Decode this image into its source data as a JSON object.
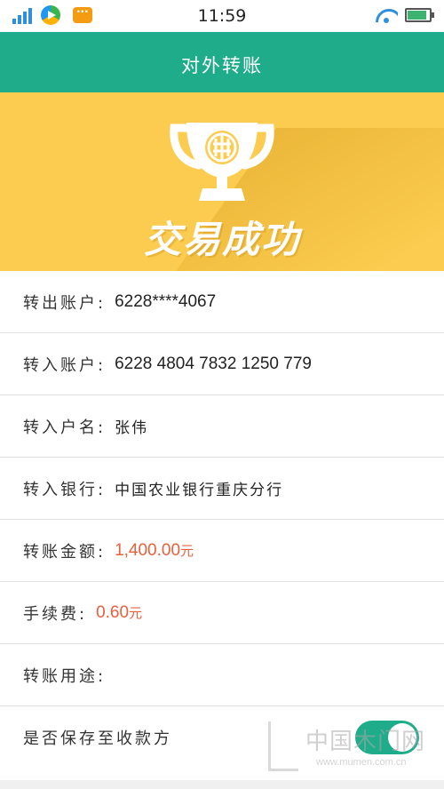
{
  "status_bar": {
    "time": "11:59",
    "battery_level": 0.9,
    "icons": [
      "signal-icon",
      "video-app-icon",
      "message-icon",
      "wifi-icon",
      "battery-icon"
    ]
  },
  "nav": {
    "title": "对外转账"
  },
  "banner": {
    "success_text": "交易成功",
    "trophy_icon": "trophy-bank-logo-icon"
  },
  "details": {
    "from_account": {
      "label": "转出账户:",
      "value": "6228****4067"
    },
    "to_account": {
      "label": "转入账户:",
      "value": "6228 4804 7832 1250 779"
    },
    "to_name": {
      "label": "转入户名:",
      "value": "张伟"
    },
    "to_bank": {
      "label": "转入银行:",
      "value": "中国农业银行重庆分行"
    },
    "amount": {
      "label": "转账金额:",
      "value": "1,400.00",
      "unit": "元"
    },
    "fee": {
      "label": "手续费:",
      "value": "0.60",
      "unit": "元"
    },
    "purpose": {
      "label": "转账用途:",
      "value": ""
    },
    "save_payee": {
      "label": "是否保存至收款方",
      "enabled": true
    }
  },
  "watermark": {
    "title": "中国木门网",
    "url": "www.mumen.com.cn"
  },
  "colors": {
    "primary": "#1fac8a",
    "banner": "#fbcc4f",
    "amount": "#e8603c"
  }
}
